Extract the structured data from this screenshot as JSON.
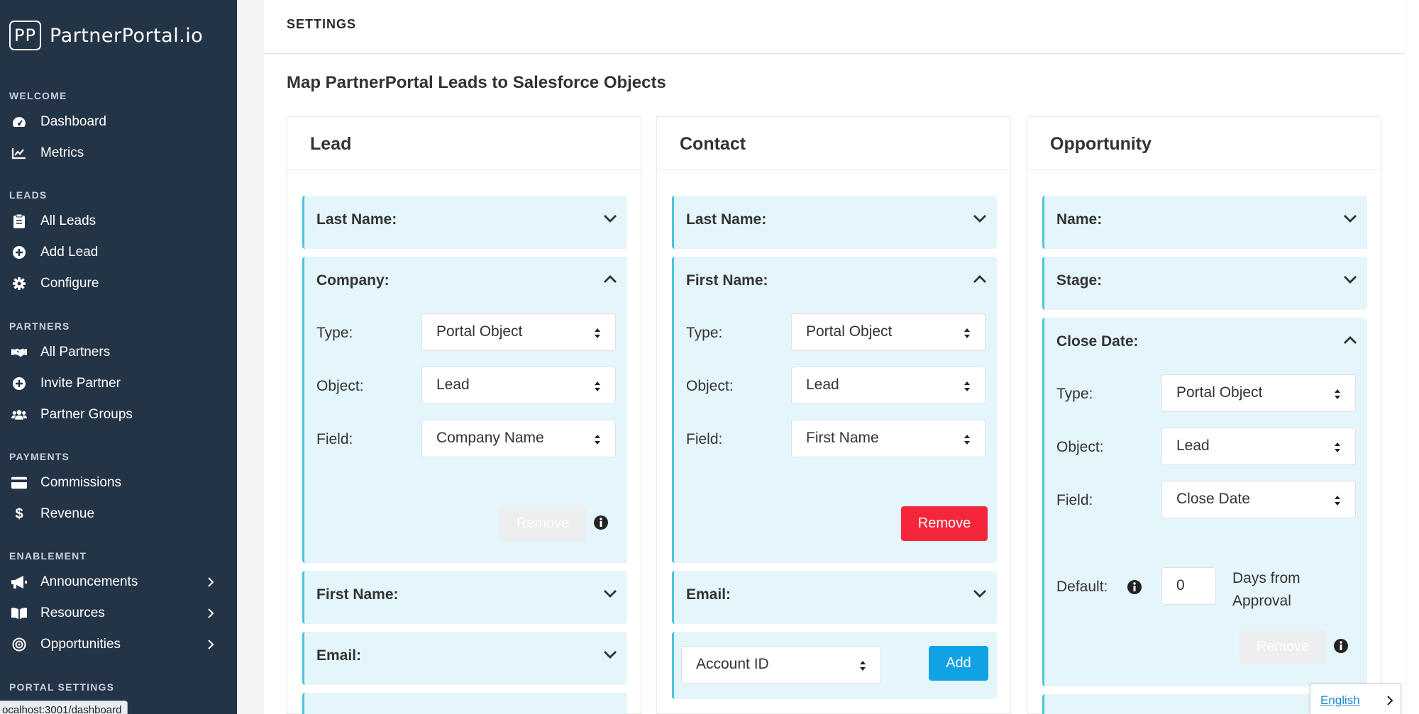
{
  "brand": {
    "logo_text": "PP",
    "name": "PartnerPortal.io"
  },
  "sidebar": {
    "sections": {
      "welcome": "WELCOME",
      "leads": "LEADS",
      "partners": "PARTNERS",
      "payments": "PAYMENTS",
      "enablement": "ENABLEMENT",
      "portal_settings": "PORTAL SETTINGS"
    },
    "items": {
      "dashboard": "Dashboard",
      "metrics": "Metrics",
      "all_leads": "All Leads",
      "add_lead": "Add Lead",
      "configure": "Configure",
      "all_partners": "All Partners",
      "invite_partner": "Invite Partner",
      "partner_groups": "Partner Groups",
      "commissions": "Commissions",
      "revenue": "Revenue",
      "announcements": "Announcements",
      "resources": "Resources",
      "opportunities": "Opportunities"
    },
    "status_url": "ocalhost:3001/dashboard"
  },
  "header": {
    "title": "SETTINGS"
  },
  "page": {
    "title": "Map PartnerPortal Leads to Salesforce Objects"
  },
  "labels": {
    "type": "Type:",
    "object": "Object:",
    "field": "Field:",
    "default": "Default:",
    "remove": "Remove",
    "add": "Add",
    "days_from": "Days from",
    "approval": "Approval"
  },
  "columns": {
    "lead": {
      "title": "Lead",
      "last_name": "Last Name:",
      "company": "Company:",
      "company_type": "Portal Object",
      "company_object": "Lead",
      "company_field": "Company Name",
      "first_name": "First Name:",
      "email": "Email:"
    },
    "contact": {
      "title": "Contact",
      "last_name": "Last Name:",
      "first_name": "First Name:",
      "first_name_type": "Portal Object",
      "first_name_object": "Lead",
      "first_name_field": "First Name",
      "email": "Email:",
      "new_field_select": "Account ID"
    },
    "opportunity": {
      "title": "Opportunity",
      "name": "Name:",
      "stage": "Stage:",
      "close_date": "Close Date:",
      "close_date_type": "Portal Object",
      "close_date_object": "Lead",
      "close_date_field": "Close Date",
      "default_value": "0"
    }
  },
  "language": {
    "current": "English"
  },
  "colors": {
    "sidebar_bg": "#243447",
    "panel_bg": "#e4f5fb",
    "panel_accent": "#4fc3dd",
    "remove_red": "#f5263c",
    "add_blue": "#10a2e3"
  }
}
